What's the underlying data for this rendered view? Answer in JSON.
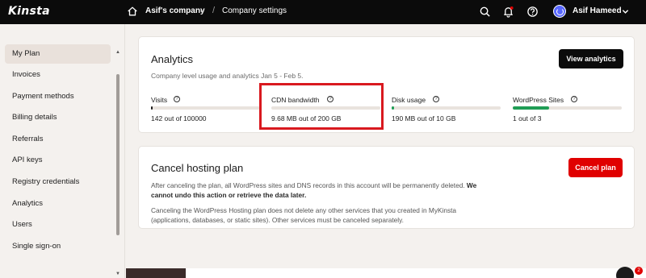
{
  "topbar": {
    "logo": "Kinsta",
    "company": "Asif's company",
    "separator": "/",
    "page": "Company settings",
    "user_name": "Asif Hameed",
    "icons": [
      "home-icon",
      "search-icon",
      "bell-icon",
      "help-icon",
      "avatar",
      "chevron-down-icon"
    ],
    "notification_dot_color": "#e00000"
  },
  "sidebar": {
    "items": [
      {
        "label": "My Plan",
        "active": true
      },
      {
        "label": "Invoices"
      },
      {
        "label": "Payment methods"
      },
      {
        "label": "Billing details"
      },
      {
        "label": "Referrals"
      },
      {
        "label": "API keys"
      },
      {
        "label": "Registry credentials"
      },
      {
        "label": "Analytics"
      },
      {
        "label": "Users"
      },
      {
        "label": "Single sign-on"
      }
    ]
  },
  "analytics": {
    "title": "Analytics",
    "subtitle": "Company level usage and analytics Jan 5 - Feb 5.",
    "button": "View analytics",
    "metrics": [
      {
        "label": "Visits",
        "value": "142 out of 100000",
        "fill": 0.0014,
        "color": "#1b1b1b"
      },
      {
        "label": "CDN bandwidth",
        "value": "9.68 MB out of 200 GB",
        "fill": 0.0,
        "color": "#1b1b1b"
      },
      {
        "label": "Disk usage",
        "value": "190 MB out of 10 GB",
        "fill": 0.019,
        "color": "#1f9d55"
      },
      {
        "label": "WordPress Sites",
        "value": "1 out of 3",
        "fill": 0.333,
        "color": "#1f9d55"
      }
    ]
  },
  "cancel": {
    "title": "Cancel hosting plan",
    "button": "Cancel plan",
    "para1_normal": "After canceling the plan, all WordPress sites and DNS records in this account will be permanently deleted. ",
    "para1_bold": "We cannot undo this action or retrieve the data later.",
    "para2": "Canceling the WordPress Hosting plan does not delete any other services that you created in MyKinsta (applications, databases, or static sites). Other services must be canceled separately."
  },
  "chat": {
    "badge": "2"
  },
  "colors": {
    "accent_red": "#e00000",
    "highlight_red": "#d9191f",
    "dark": "#0b0b0b",
    "green": "#1f9d55"
  }
}
